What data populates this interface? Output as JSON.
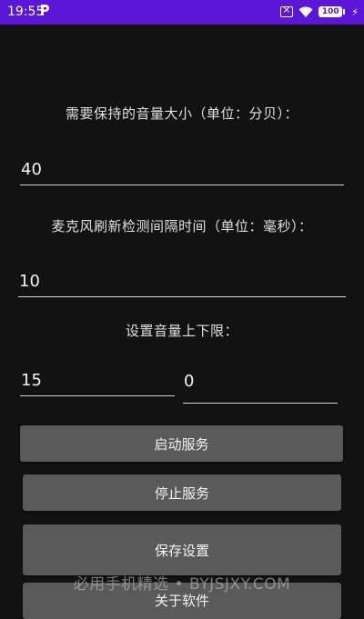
{
  "status_bar": {
    "time": "19:55",
    "battery": "100",
    "accent_color": "#5b16d8"
  },
  "volume_section": {
    "label": "需要保持的音量大小（单位：分贝）：",
    "value": "40"
  },
  "interval_section": {
    "label": "麦克风刷新检测间隔时间（单位：毫秒）：",
    "value": "10"
  },
  "limit_section": {
    "label": "设置音量上下限：",
    "lower_value": "15",
    "upper_value": "0"
  },
  "buttons": {
    "start": "启动服务",
    "stop": "停止服务",
    "save": "保存设置",
    "about": "关于软件"
  },
  "watermark": "必用手机精选 • BYJSJXY.COM"
}
